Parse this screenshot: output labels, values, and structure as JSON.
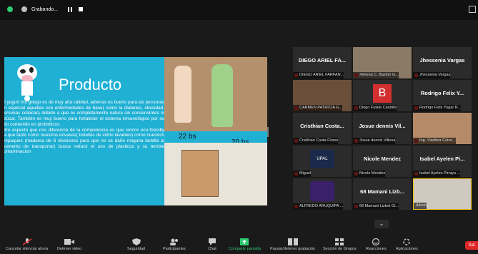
{
  "window": {
    "recording_label": "Grabando...",
    "colors": {
      "background": "#1a1a1a",
      "slide_bg": "#1fb0d4",
      "accent_green": "#2ecc71",
      "leave_red": "#e02828"
    }
  },
  "slide": {
    "title": "Producto",
    "paragraph1": "El yogurt mu griego es de muy alta calidad, ademas es bueno para las personas en especial aquellas con enfermedades de base( como la diabetes, obesidad, personas celiacas) debido a que es completamente natura sin conservantes ni azúcar. También es muy bueno para fortalecer el sistema inmunológico por su alto contenido en probióticos.",
    "paragraph2": "Otro aspecto que nos diferencia de la competencia es que somos eco-friendly ya que tanto como nuestros envases( botellas de vidrio lavables) como nuestros empaques (maderea de 6 divisiones para que no se dañe ninguna botella al momento de transportar) busca reducir el uso de plasticos y su tembie contaminacion",
    "price1": "22 bs",
    "price2": "20 bs"
  },
  "participants": [
    {
      "name": "DIEGO ARIEL FA...",
      "caption": "DIEGO ARIEL FARFAN...",
      "type": "name"
    },
    {
      "name": "",
      "caption": "Ximena C. Bastón G...",
      "type": "video"
    },
    {
      "name": "Jhessenia Vargas",
      "caption": "Jhessenia Vargas",
      "type": "name"
    },
    {
      "name": "",
      "caption": "CARMEN PATRICIA G...",
      "type": "video"
    },
    {
      "name": "B",
      "caption": "Diego Fulate Castrillo",
      "type": "avatar"
    },
    {
      "name": "Rodrigo Felix Y...",
      "caption": "Rodrigo Felix Yugar R...",
      "type": "name"
    },
    {
      "name": "Cristhian Costa...",
      "caption": "Cristhian Costa Flores",
      "type": "name"
    },
    {
      "name": "Josue dennis Vil...",
      "caption": "Josue dennis Villena",
      "type": "name"
    },
    {
      "name": "",
      "caption": "Ing. Vladimir Colvo...",
      "type": "video"
    },
    {
      "name": "UPAL",
      "caption": "Miguel",
      "type": "logo"
    },
    {
      "name": "Nicole Mendez",
      "caption": "Nicole Mendez",
      "type": "name"
    },
    {
      "name": "Isabel Ayelen Pi...",
      "caption": "Isabel Ayelen Pinaya ...",
      "type": "name"
    },
    {
      "name": "",
      "caption": "ALFREDO ARUQUIPA ...",
      "type": "logo-a"
    },
    {
      "name": "68 Mamani Lizb...",
      "caption": "68 Mamani Lizbet Gi...",
      "type": "name"
    },
    {
      "name": "",
      "caption": "Alison",
      "type": "video"
    }
  ],
  "toolbar": {
    "items": [
      {
        "label": "Cancelar silenciar ahora",
        "icon": "mic-off-icon"
      },
      {
        "label": "Detener video",
        "icon": "video-icon"
      },
      {
        "label": "Seguridad",
        "icon": "shield-icon"
      },
      {
        "label": "Participantes",
        "icon": "people-icon",
        "count": "38"
      },
      {
        "label": "Chat",
        "icon": "chat-icon"
      },
      {
        "label": "Compartir pantalla",
        "icon": "share-screen-icon"
      },
      {
        "label": "Pausar/detener grabación",
        "icon": "record-icon"
      },
      {
        "label": "Sección de Grupos",
        "icon": "breakout-icon"
      },
      {
        "label": "Reacciones",
        "icon": "smile-icon"
      },
      {
        "label": "Aplicaciones",
        "icon": "apps-icon"
      }
    ],
    "leave_label": "Sal"
  }
}
